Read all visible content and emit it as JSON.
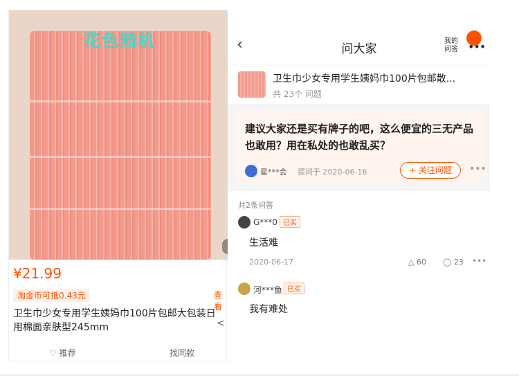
{
  "left": {
    "overlay_text": "花色随机",
    "price": "¥21.99",
    "coin_text": "淘金币可抵0.43元",
    "view_link": "查看",
    "title": "卫生巾少女专用学生姨妈巾100片包邮大包装日用棉面亲肤型245mm",
    "actions": {
      "recommend": "♡ 推荐",
      "similar": "找同款"
    }
  },
  "right": {
    "header": {
      "back": "‹",
      "title": "问大家",
      "my_questions": "我的问答",
      "more": "•••"
    },
    "product": {
      "name": "卫生巾少女专用学生姨妈巾100片包邮散...",
      "count": "共 23个 问题"
    },
    "question": {
      "text": "建议大家还是买有牌子的吧，这么便宜的三无产品也敢用？用在私处的也敢乱买？",
      "asker": "星***会",
      "asked_date": "提问于 2020-06-16",
      "follow": "+ 关注问题",
      "more": "•••"
    },
    "answers_count": "共2条问答",
    "answers": [
      {
        "name": "G***0",
        "badge": "已买",
        "text": "生活难",
        "date": "2020-06-17",
        "likes": "△ 60",
        "comments": "◯ 23",
        "more": "•••",
        "avatar_color": "#444444"
      },
      {
        "name": "河***鱼",
        "badge": "已买",
        "text": "我有难处",
        "avatar_color": "#c9a24a"
      }
    ]
  },
  "colors": {
    "accent": "#ff5000",
    "overlay": "#4bd6c4",
    "pad": "#f39a8c"
  }
}
